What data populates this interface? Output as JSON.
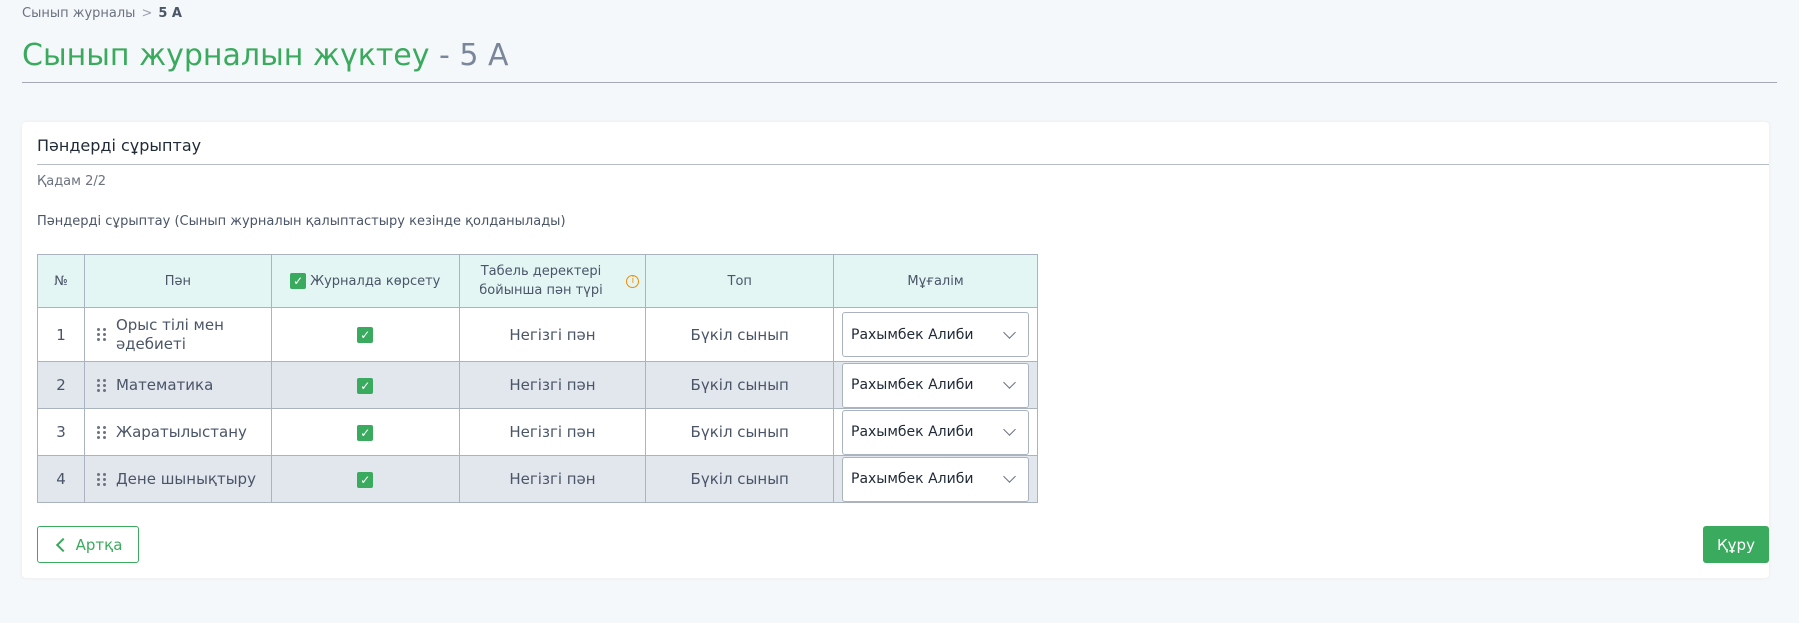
{
  "breadcrumb": {
    "parent": "Сынып журналы",
    "separator": ">",
    "current": "5 А"
  },
  "page": {
    "title_main": "Сынып журналын жүктеу",
    "title_sub": " - 5 А"
  },
  "card": {
    "title": "Пәндерді сұрыптау",
    "step": "Қадам 2/2",
    "description": "Пәндерді сұрыптау (Сынып журналын қалыптастыру кезінде қолданылады)"
  },
  "table": {
    "headers": {
      "num": "№",
      "subject": "Пән",
      "show": "Журналда көрсету",
      "type": "Табель деректері бойынша пән түрі",
      "group": "Топ",
      "teacher": "Мұғалім"
    },
    "rows": [
      {
        "num": "1",
        "subject": "Орыс тілі мен әдебиеті",
        "show": true,
        "type": "Негізгі пән",
        "group": "Бүкіл сынып",
        "teacher": "Рахымбек Алиби"
      },
      {
        "num": "2",
        "subject": "Математика",
        "show": true,
        "type": "Негізгі пән",
        "group": "Бүкіл сынып",
        "teacher": "Рахымбек Алиби"
      },
      {
        "num": "3",
        "subject": "Жаратылыстану",
        "show": true,
        "type": "Негізгі пән",
        "group": "Бүкіл сынып",
        "teacher": "Рахымбек Алиби"
      },
      {
        "num": "4",
        "subject": "Дене шынықтыру",
        "show": true,
        "type": "Негізгі пән",
        "group": "Бүкіл сынып",
        "teacher": "Рахымбек Алиби"
      }
    ]
  },
  "buttons": {
    "back": "Артқа",
    "create": "Құру"
  },
  "colors": {
    "accent": "#3aaa5e",
    "header_bg": "#e3f6f4",
    "alt_row": "#e2e6ed",
    "info": "#f08c00"
  }
}
